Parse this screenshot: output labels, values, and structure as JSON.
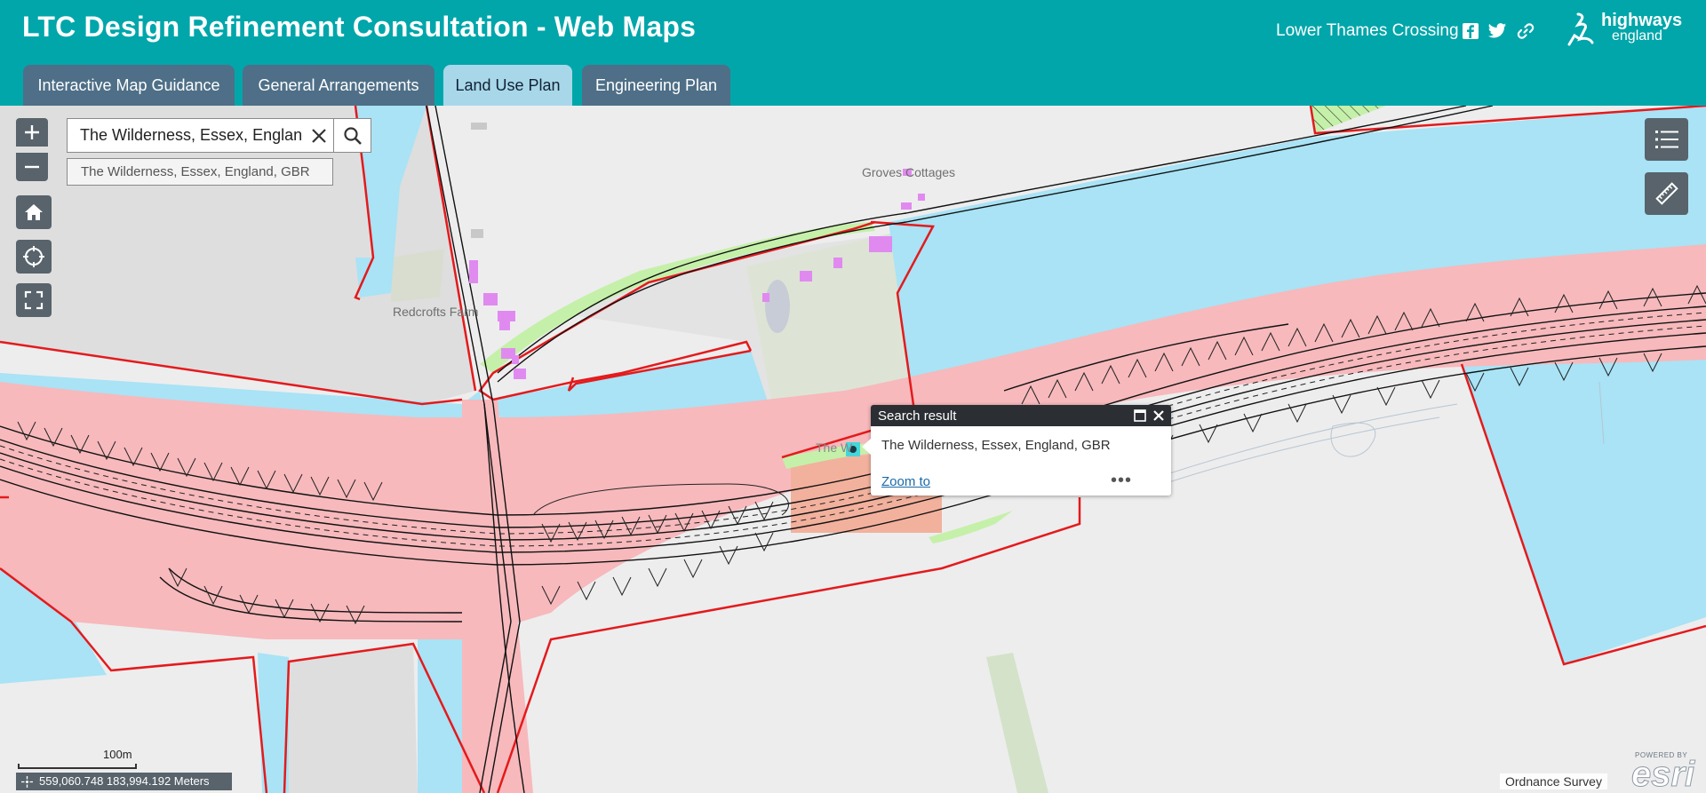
{
  "header": {
    "title": "LTC Design Refinement Consultation - Web Maps",
    "project": "Lower Thames Crossing",
    "logo_line1": "highways",
    "logo_line2": "england"
  },
  "tabs": [
    {
      "label": "Interactive Map Guidance",
      "active": false
    },
    {
      "label": "General Arrangements",
      "active": false
    },
    {
      "label": "Land Use Plan",
      "active": true
    },
    {
      "label": "Engineering Plan",
      "active": false
    }
  ],
  "search": {
    "value": "The Wilderness, Essex, England",
    "suggestion": "The Wilderness, Essex, England, GBR"
  },
  "map_labels": {
    "groves_cottages": "Groves Cottages",
    "redcrofts_farm": "Redcrofts Farm",
    "the_w": "The W"
  },
  "popup": {
    "title": "Search result",
    "body": "The Wilderness, Essex, England, GBR",
    "zoom_link": "Zoom to",
    "more": "•••"
  },
  "scalebar": {
    "label": "100m"
  },
  "coordinates": "559,060.748 183,994.192 Meters",
  "attribution": "Ordnance Survey",
  "esri": {
    "powered": "POWERED BY",
    "word": "esri"
  },
  "colors": {
    "header": "#00a6aa",
    "tab": "#4e6f87",
    "tab_active": "#a8d7ea",
    "water_blue": "#a9e3f5",
    "land_pink": "#f7b9bc",
    "boundary_red": "#e41a1c",
    "green_strip": "#c5f0a9",
    "control_grey": "#58636b"
  },
  "icons": {
    "facebook": "facebook-icon",
    "twitter": "twitter-icon",
    "link": "link-icon",
    "zoom_in": "plus-icon",
    "zoom_out": "minus-icon",
    "home": "home-icon",
    "locate": "locate-icon",
    "fullscreen": "fullscreen-icon",
    "layers": "layer-list-icon",
    "measure": "ruler-icon"
  }
}
